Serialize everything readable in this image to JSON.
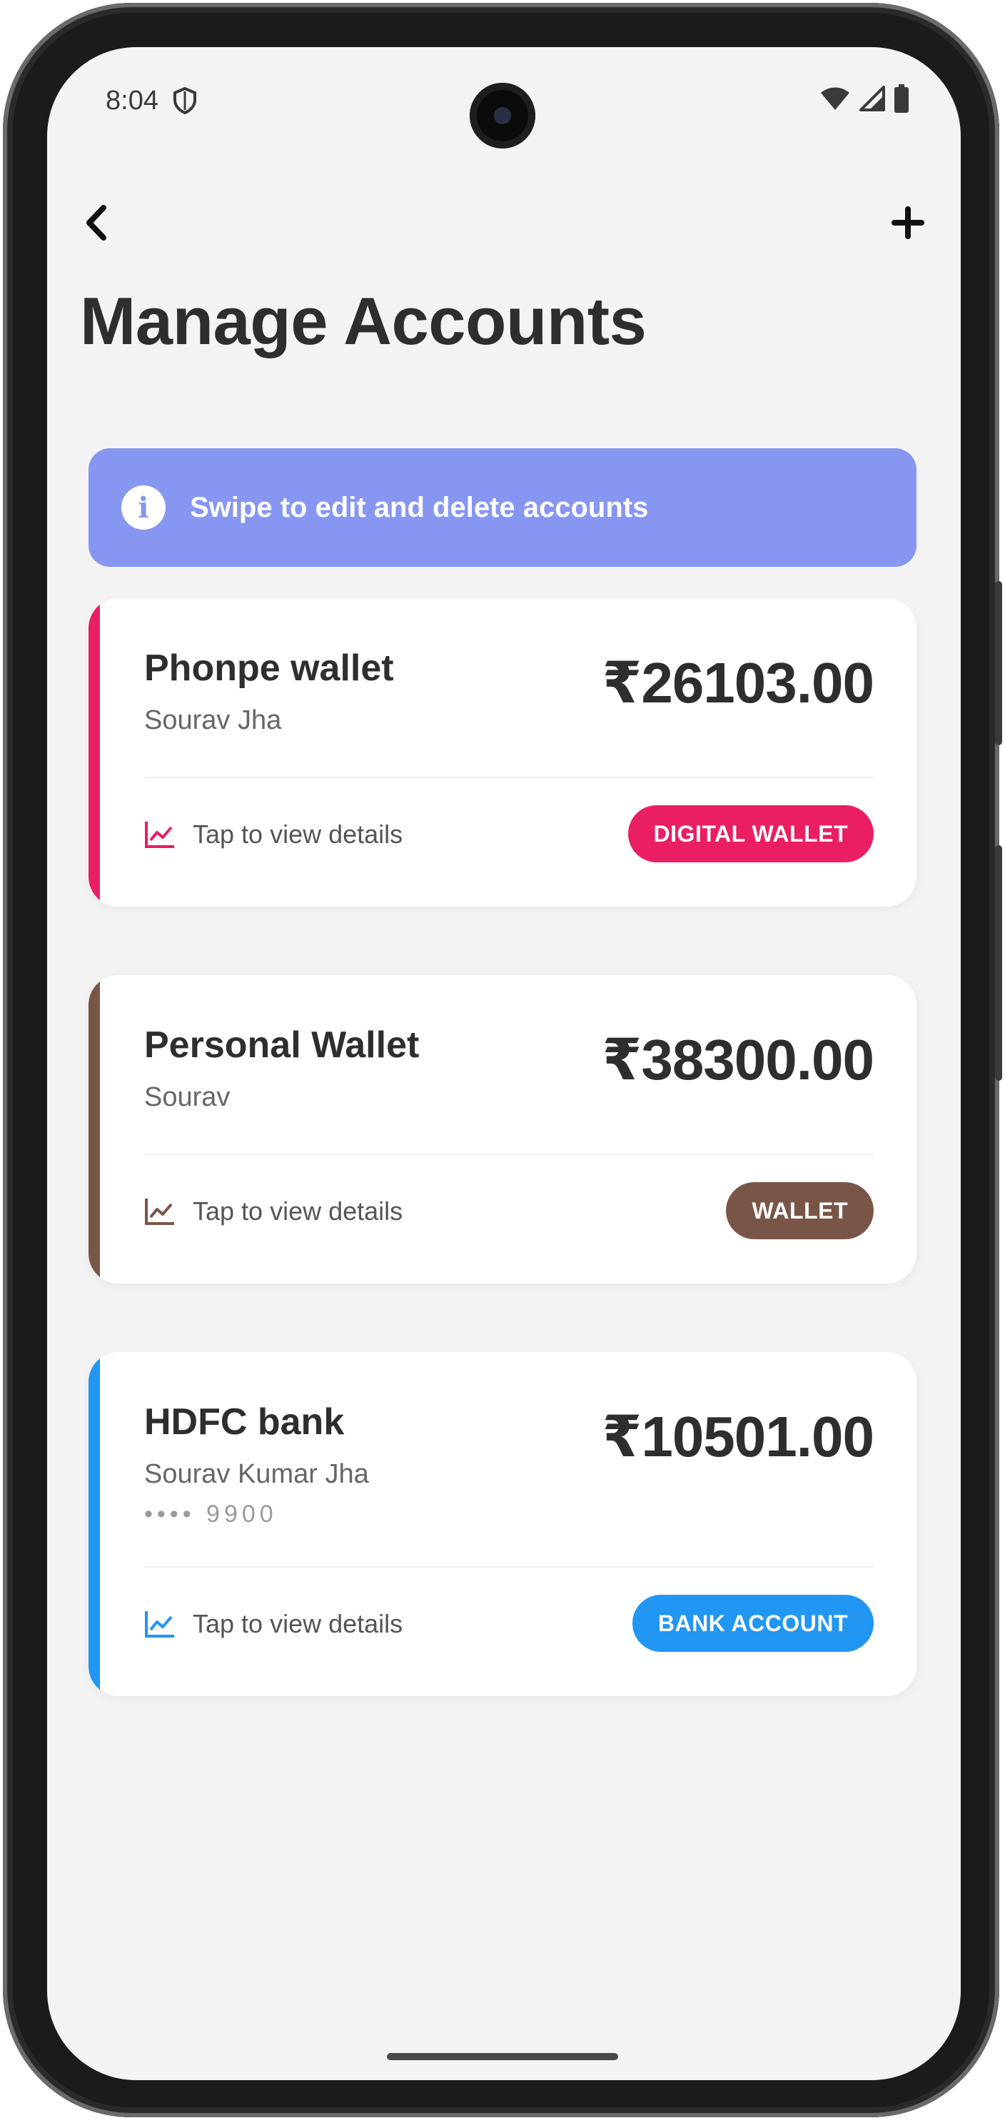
{
  "status_bar": {
    "time": "8:04"
  },
  "header": {
    "title": "Manage Accounts",
    "back_icon": "chevron-left-icon",
    "add_icon": "plus-icon"
  },
  "banner": {
    "text": "Swipe to edit and delete accounts",
    "icon": "info-icon",
    "color": "#8696f1"
  },
  "accounts": [
    {
      "name": "Phonpe wallet",
      "owner": "Sourav Jha",
      "balance": "₹26103.00",
      "detail_label": "Tap to view details",
      "type_label": "DIGITAL WALLET",
      "color": "#e91e63"
    },
    {
      "name": "Personal Wallet",
      "owner": "Sourav",
      "balance": "₹38300.00",
      "detail_label": "Tap to view details",
      "type_label": "WALLET",
      "color": "#795548"
    },
    {
      "name": "HDFC bank",
      "owner": "Sourav Kumar Jha",
      "masked_number": "•••• 9900",
      "balance": "₹10501.00",
      "detail_label": "Tap to view details",
      "type_label": "BANK ACCOUNT",
      "color": "#2196f3"
    }
  ]
}
